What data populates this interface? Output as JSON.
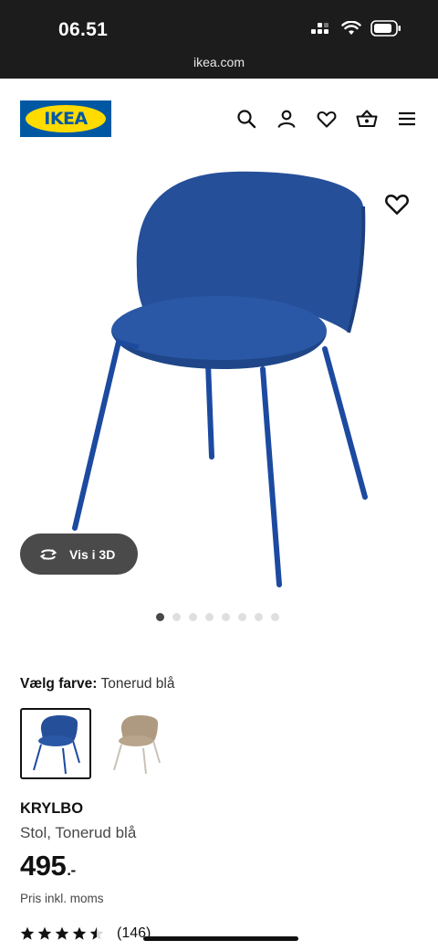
{
  "status": {
    "time": "06.51",
    "url": "ikea.com"
  },
  "header": {
    "logo_text": "IKEA",
    "brand_colors": {
      "blue": "#0058a3",
      "yellow": "#ffdb00"
    },
    "icons": [
      "search-icon",
      "account-icon",
      "favourites-icon",
      "basket-icon",
      "menu-icon"
    ]
  },
  "product": {
    "view_3d_label": "Vis i 3D",
    "image_count": 8,
    "active_image": 1,
    "chair_color": "#1f4f9e"
  },
  "color_picker": {
    "label": "Vælg farve:",
    "selected": "Tonerud blå",
    "options": [
      {
        "name": "Tonerud blå",
        "color": "#1f4f9e"
      },
      {
        "name": "beige",
        "color": "#b8a58b"
      }
    ]
  },
  "info": {
    "name": "KRYLBO",
    "description": "Stol, Tonerud blå",
    "price": "495",
    "price_suffix": ".-",
    "vat_note": "Pris inkl. moms",
    "rating_stars": 4.5,
    "review_count": "(146)"
  }
}
